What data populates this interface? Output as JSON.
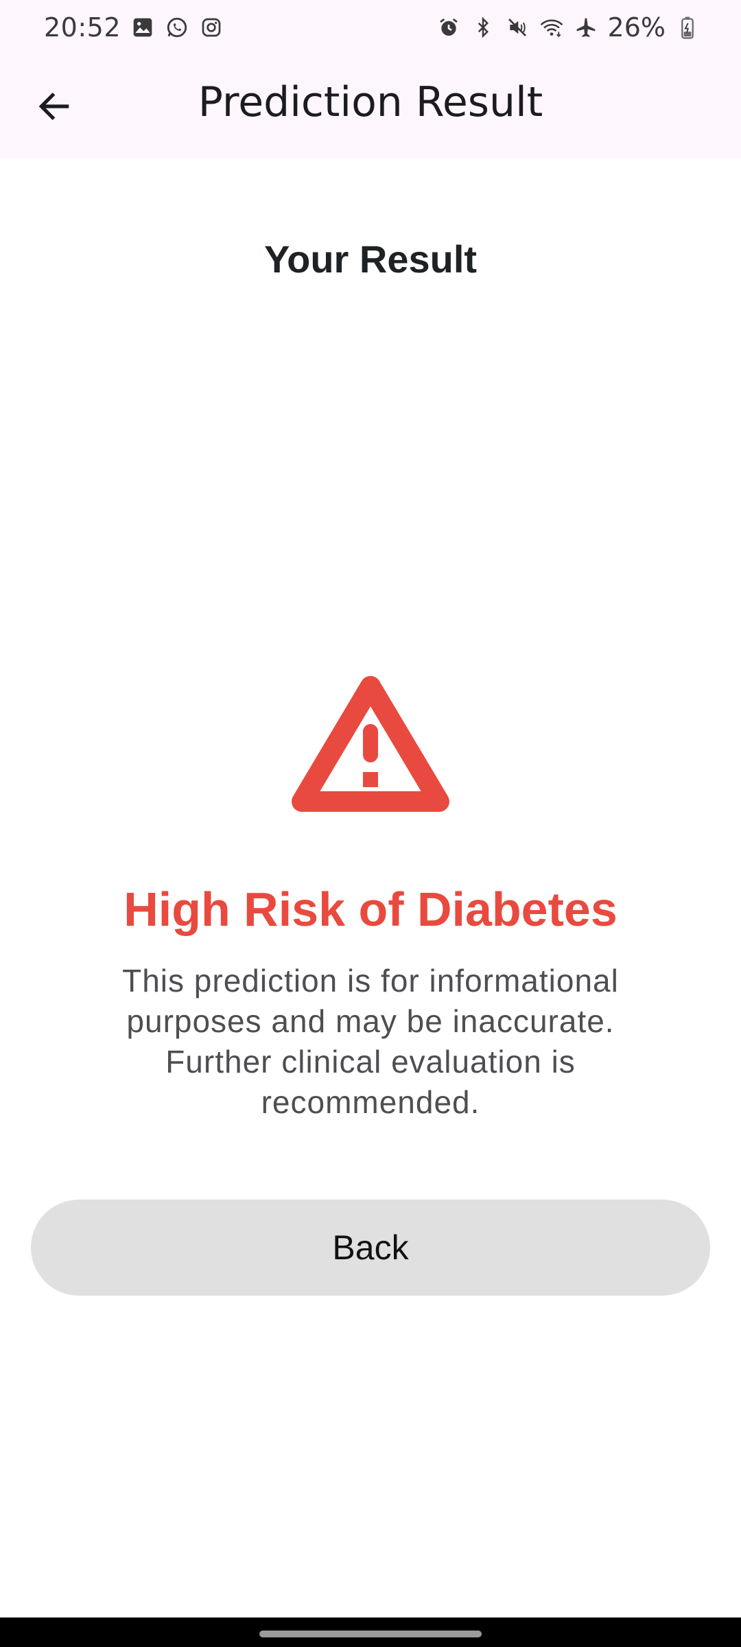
{
  "status_bar": {
    "time": "20:52",
    "battery": "26%",
    "icons_left": [
      "gallery-icon",
      "whatsapp-icon",
      "instagram-icon"
    ],
    "icons_right": [
      "alarm-icon",
      "bluetooth-icon",
      "mute-icon",
      "wifi-icon",
      "airplane-icon",
      "battery-icon"
    ]
  },
  "app_bar": {
    "title": "Prediction Result",
    "back_icon": "arrow-left-icon"
  },
  "main": {
    "heading": "Your Result",
    "status_icon": "warning-icon",
    "result_title": "High Risk of Diabetes",
    "disclaimer": "This prediction is for informational purposes and may be inaccurate. Further clinical evaluation is recommended.",
    "back_button_label": "Back"
  },
  "colors": {
    "accent_red": "#e94a3f",
    "app_bar_bg": "#fdf6fd",
    "button_bg": "#e0e0e0"
  }
}
